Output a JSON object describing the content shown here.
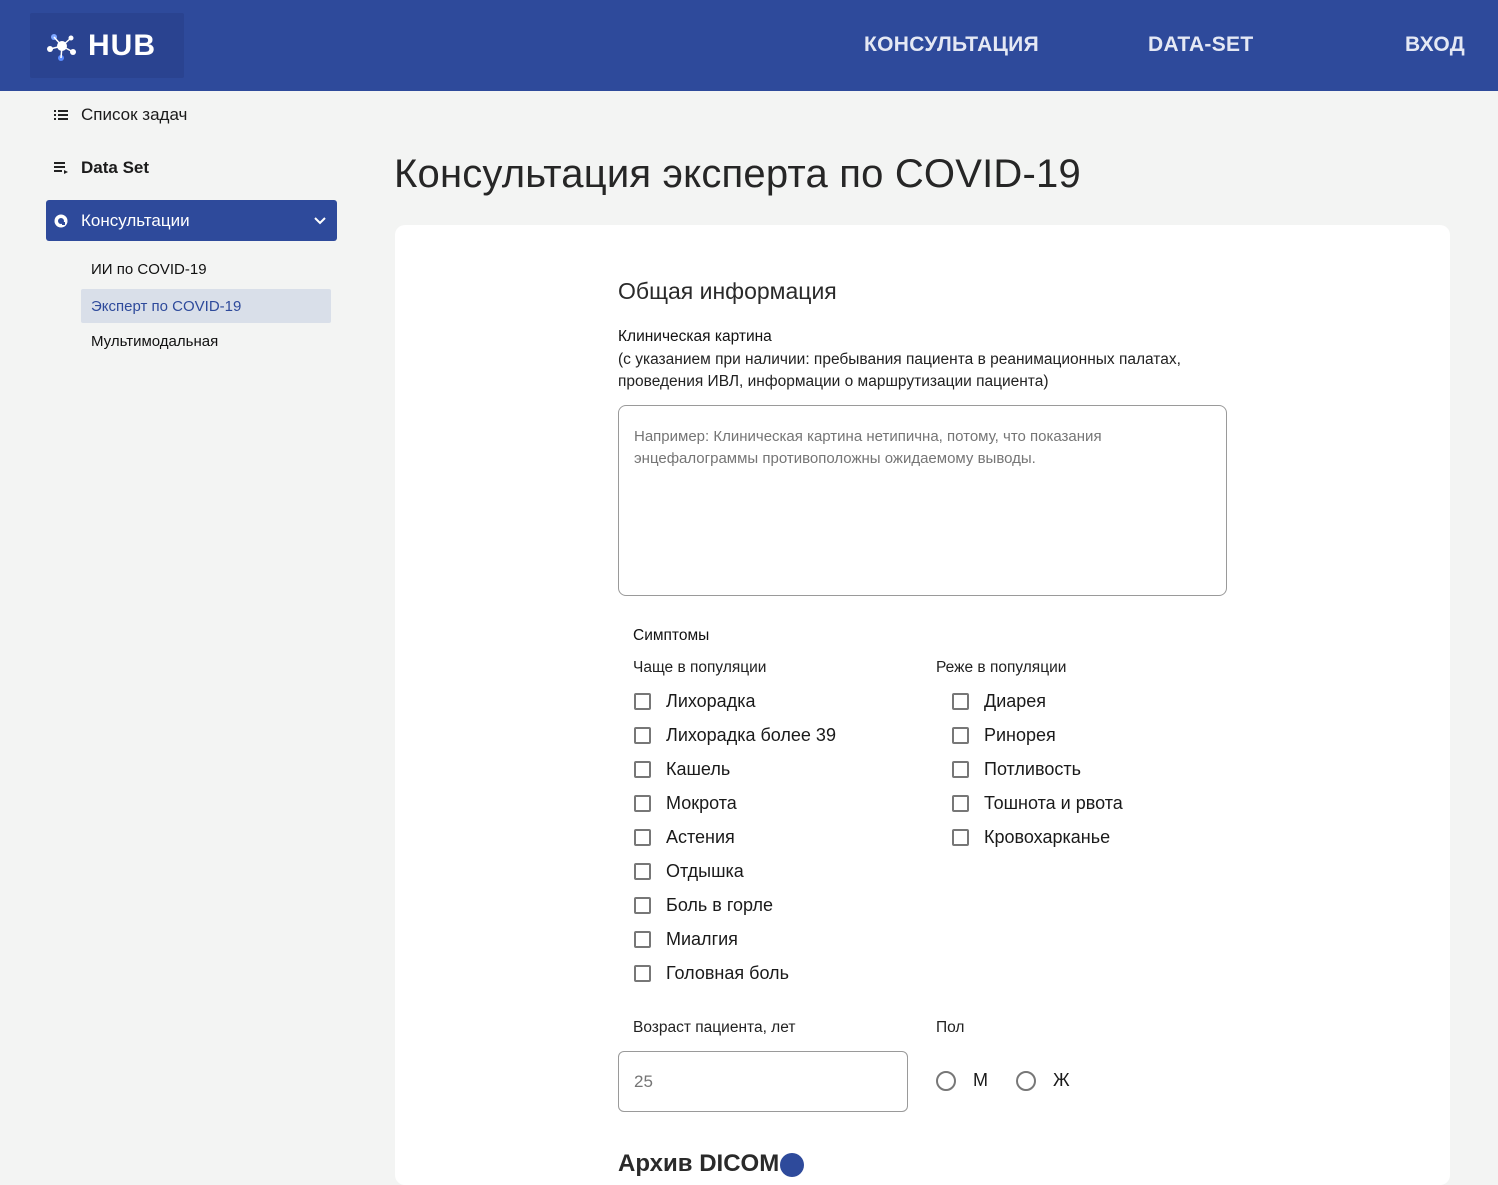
{
  "header": {
    "logo_text": "HUB",
    "nav": {
      "consultation": "КОНСУЛЬТАЦИЯ",
      "dataset": "DATA-SET",
      "login": "ВХОД"
    },
    "bg_color": "#2e4a9b"
  },
  "sidebar": {
    "items": [
      {
        "label": "Список задач",
        "icon": "list-icon"
      },
      {
        "label": "Data Set",
        "icon": "dataset-icon"
      },
      {
        "label": "Консультации",
        "icon": "consult-icon",
        "active": true
      }
    ],
    "subitems": [
      {
        "label": "ИИ по COVID-19"
      },
      {
        "label": "Эксперт по COVID-19",
        "selected": true
      },
      {
        "label": "Мультимодальная"
      }
    ]
  },
  "main": {
    "title": "Консультация эксперта по COVID-19",
    "section_title": "Общая информация",
    "clinical": {
      "label": "Клиническая картина",
      "hint": "(с указанием при наличии: пребывания пациента в реанимационных палатах, проведения ИВЛ, информации о маршрутизации пациента)",
      "placeholder": "Например: Клиническая картина нетипична, потому, что показания энцефалограммы противоположны ожидаемому выводы."
    },
    "symptoms": {
      "title": "Симптомы",
      "frequent_label": "Чаще в популяции",
      "rare_label": "Реже в популяции",
      "frequent": [
        "Лихорадка",
        "Лихорадка более 39",
        "Кашель",
        "Мокрота",
        "Астения",
        "Отдышка",
        "Боль в горле",
        "Миалгия",
        "Головная боль"
      ],
      "rare": [
        "Диарея",
        "Ринорея",
        "Потливость",
        "Тошнота и рвота",
        "Кровохарканье"
      ]
    },
    "age": {
      "label": "Возраст пациента, лет",
      "placeholder": "25"
    },
    "sex": {
      "label": "Пол",
      "options": [
        "М",
        "Ж"
      ]
    },
    "next_section_partial": "Архив DICOM"
  }
}
